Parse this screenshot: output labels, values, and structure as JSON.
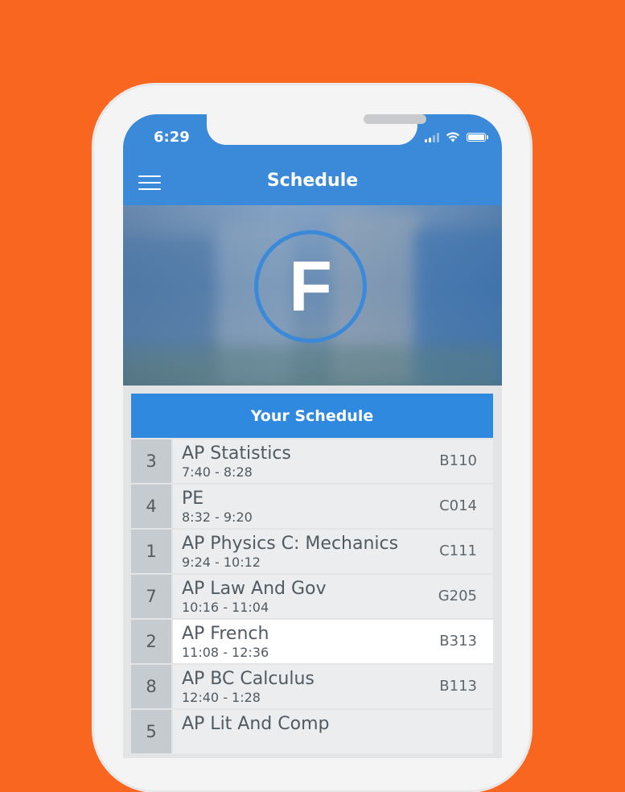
{
  "status_bar": {
    "time": "6:29"
  },
  "app": {
    "title": "Schedule",
    "logo_letter": "F"
  },
  "schedule": {
    "heading": "Your Schedule",
    "rows": [
      {
        "period": "3",
        "course": "AP Statistics",
        "time": "7:40 - 8:28",
        "room": "B110"
      },
      {
        "period": "4",
        "course": "PE",
        "time": "8:32 - 9:20",
        "room": "C014"
      },
      {
        "period": "1",
        "course": "AP Physics C: Mechanics",
        "time": "9:24 - 10:12",
        "room": "C111"
      },
      {
        "period": "7",
        "course": "AP Law And Gov",
        "time": "10:16 - 11:04",
        "room": "G205"
      },
      {
        "period": "2",
        "course": "AP French",
        "time": "11:08 - 12:36",
        "room": "B313"
      },
      {
        "period": "8",
        "course": "AP BC Calculus",
        "time": "12:40 - 1:28",
        "room": "B113"
      },
      {
        "period": "5",
        "course": "AP Lit And Comp",
        "time": "",
        "room": ""
      }
    ]
  },
  "colors": {
    "background": "#F8661F",
    "accent": "#3A8AD9",
    "highlight_row": "#FFFFFF"
  },
  "icons": [
    "menu-icon",
    "signal-icon",
    "wifi-icon",
    "battery-icon"
  ]
}
